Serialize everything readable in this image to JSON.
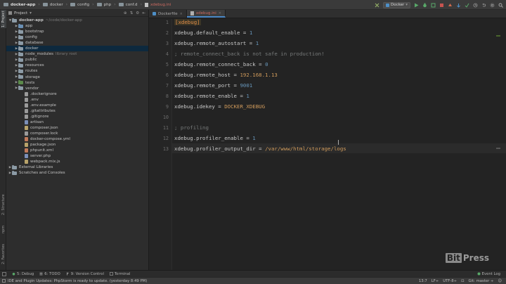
{
  "breadcrumbs": [
    "docker-app",
    "docker",
    "config",
    "php",
    "conf.d",
    "xdebug.ini"
  ],
  "toolbar": {
    "run_config": "Docker"
  },
  "left_tool_tabs": [
    "1: Project",
    "2: Structure",
    "npm",
    "2: Favorites"
  ],
  "project_panel": {
    "title": "Project"
  },
  "tree": [
    {
      "label": "docker-app",
      "hint": "~/code/docker-app",
      "indent": 0,
      "arrow": "▼",
      "kind": "folder",
      "color": "#8c9ba6",
      "bold": true
    },
    {
      "label": "app",
      "indent": 1,
      "arrow": "▶",
      "kind": "folder",
      "color": "#6a8fb3"
    },
    {
      "label": "bootstrap",
      "indent": 1,
      "arrow": "▶",
      "kind": "folder",
      "color": "#8c9ba6"
    },
    {
      "label": "config",
      "indent": 1,
      "arrow": "▶",
      "kind": "folder",
      "color": "#8c9ba6"
    },
    {
      "label": "database",
      "indent": 1,
      "arrow": "▶",
      "kind": "folder",
      "color": "#8c9ba6"
    },
    {
      "label": "docker",
      "indent": 1,
      "arrow": "▶",
      "kind": "folder",
      "color": "#8c9ba6",
      "selected": true
    },
    {
      "label": "node_modules",
      "hint": "library root",
      "indent": 1,
      "arrow": "▶",
      "kind": "folder",
      "color": "#8c9ba6"
    },
    {
      "label": "public",
      "indent": 1,
      "arrow": "▶",
      "kind": "folder",
      "color": "#8c9ba6"
    },
    {
      "label": "resources",
      "indent": 1,
      "arrow": "▶",
      "kind": "folder",
      "color": "#8c9ba6"
    },
    {
      "label": "routes",
      "indent": 1,
      "arrow": "▶",
      "kind": "folder",
      "color": "#8c9ba6"
    },
    {
      "label": "storage",
      "indent": 1,
      "arrow": "▶",
      "kind": "folder",
      "color": "#8c9ba6"
    },
    {
      "label": "tests",
      "indent": 1,
      "arrow": "▶",
      "kind": "folder",
      "color": "#5a8a4a"
    },
    {
      "label": "vendor",
      "indent": 1,
      "arrow": "▶",
      "kind": "folder",
      "color": "#8c9ba6"
    },
    {
      "label": ".dockerignore",
      "indent": 2,
      "kind": "file",
      "color": "#9a9a9a"
    },
    {
      "label": ".env",
      "indent": 2,
      "kind": "file",
      "color": "#9a9a9a"
    },
    {
      "label": ".env.example",
      "indent": 2,
      "kind": "file",
      "color": "#9a9a9a"
    },
    {
      "label": ".gitattributes",
      "indent": 2,
      "kind": "file",
      "color": "#9a9a9a"
    },
    {
      "label": ".gitignore",
      "indent": 2,
      "kind": "file",
      "color": "#9a9a9a"
    },
    {
      "label": "artisan",
      "indent": 2,
      "kind": "file",
      "color": "#7b8fb8"
    },
    {
      "label": "composer.json",
      "indent": 2,
      "kind": "file",
      "color": "#b8a36a"
    },
    {
      "label": "composer.lock",
      "indent": 2,
      "kind": "file",
      "color": "#9a9a9a"
    },
    {
      "label": "docker-compose.yml",
      "indent": 2,
      "kind": "file",
      "color": "#c27a5a"
    },
    {
      "label": "package.json",
      "indent": 2,
      "kind": "file",
      "color": "#b8a36a"
    },
    {
      "label": "phpunit.xml",
      "indent": 2,
      "kind": "file",
      "color": "#c27a5a"
    },
    {
      "label": "server.php",
      "indent": 2,
      "kind": "file",
      "color": "#7b8fb8"
    },
    {
      "label": "webpack.mix.js",
      "indent": 2,
      "kind": "file",
      "color": "#b8a36a"
    },
    {
      "label": "External Libraries",
      "indent": 0,
      "arrow": "▶",
      "kind": "lib",
      "color": "#8c9ba6"
    },
    {
      "label": "Scratches and Consoles",
      "indent": 0,
      "arrow": "▶",
      "kind": "lib",
      "color": "#8c9ba6"
    }
  ],
  "editor_tabs": [
    {
      "label": "Dockerfile",
      "active": false
    },
    {
      "label": "xdebug.ini",
      "active": true
    }
  ],
  "line_numbers": [
    "1",
    "2",
    "3",
    "4",
    "5",
    "6",
    "7",
    "8",
    "9",
    "10",
    "11",
    "12",
    "13"
  ],
  "code_lines": [
    [
      {
        "t": "[xdebug]",
        "c": "sect"
      }
    ],
    [
      {
        "t": "xdebug.default_enable",
        "c": "k"
      },
      {
        "t": " = ",
        "c": "eq"
      },
      {
        "t": "1",
        "c": "num"
      }
    ],
    [
      {
        "t": "xdebug.remote_autostart",
        "c": "k"
      },
      {
        "t": " = ",
        "c": "eq"
      },
      {
        "t": "1",
        "c": "num"
      }
    ],
    [
      {
        "t": "; remote_connect_back is not safe in production!",
        "c": "cm"
      }
    ],
    [
      {
        "t": "xdebug.remote_connect_back",
        "c": "k"
      },
      {
        "t": " = ",
        "c": "eq"
      },
      {
        "t": "0",
        "c": "num"
      }
    ],
    [
      {
        "t": "xdebug.remote_host",
        "c": "k"
      },
      {
        "t": " = ",
        "c": "eq"
      },
      {
        "t": "192.168.1.13",
        "c": "str"
      }
    ],
    [
      {
        "t": "xdebug.remote_port",
        "c": "k"
      },
      {
        "t": " = ",
        "c": "eq"
      },
      {
        "t": "9001",
        "c": "num"
      }
    ],
    [
      {
        "t": "xdebug.remote_enable",
        "c": "k"
      },
      {
        "t": " = ",
        "c": "eq"
      },
      {
        "t": "1",
        "c": "num"
      }
    ],
    [
      {
        "t": "xdebug.idekey",
        "c": "k"
      },
      {
        "t": " = ",
        "c": "eq"
      },
      {
        "t": "DOCKER_XDEBUG",
        "c": "str"
      }
    ],
    [],
    [
      {
        "t": "; profiling",
        "c": "cm"
      }
    ],
    [
      {
        "t": "xdebug.profiler_enable",
        "c": "k"
      },
      {
        "t": " = ",
        "c": "eq"
      },
      {
        "t": "1",
        "c": "num"
      }
    ],
    [
      {
        "t": "xdebug.profiler_output_dir",
        "c": "k"
      },
      {
        "t": " = ",
        "c": "eq"
      },
      {
        "t": "/var/www/html/storage/logs",
        "c": "str"
      }
    ]
  ],
  "watermark": {
    "left": "Bit",
    "right": "Press"
  },
  "bottom_tools": [
    {
      "label": "5: Debug",
      "icon": "bug-icon"
    },
    {
      "label": "6: TODO",
      "icon": "todo-icon"
    },
    {
      "label": "9: Version Control",
      "icon": "version-control-icon"
    },
    {
      "label": "Terminal",
      "icon": "terminal-icon"
    }
  ],
  "event_log": "Event Log",
  "status": {
    "message": "IDE and Plugin Updates: PhpStorm is ready to update. (yesterday 8:49 PM)",
    "position": "13:7",
    "line_sep": "LF÷",
    "encoding": "UTF-8÷",
    "vcs": "Git: master ÷"
  },
  "colors": {
    "accent": "#4a88c7",
    "selection": "#0d293e",
    "active_tab_text": "#cc6a60"
  }
}
